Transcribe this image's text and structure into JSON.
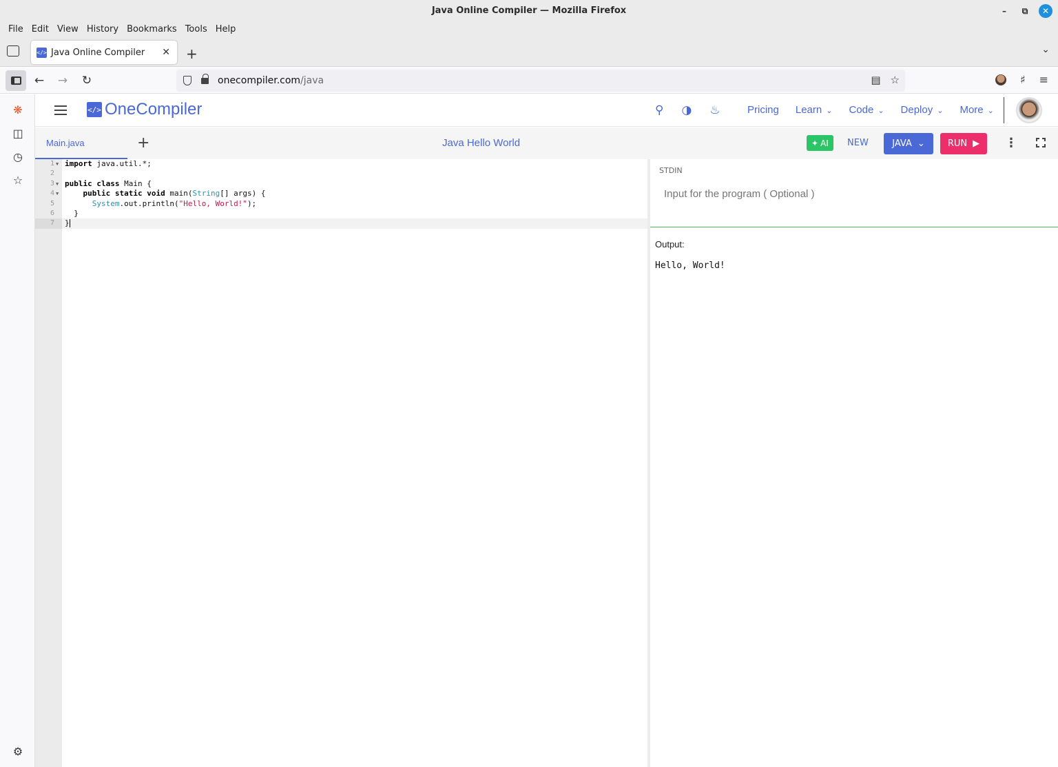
{
  "window": {
    "title": "Java Online Compiler — Mozilla Firefox"
  },
  "menu": [
    "File",
    "Edit",
    "View",
    "History",
    "Bookmarks",
    "Tools",
    "Help"
  ],
  "tab": {
    "favicon_text": "</>",
    "label": "Java Online Compiler"
  },
  "url": {
    "host": "onecompiler.com",
    "path": "/java"
  },
  "site": {
    "logo_text": "</>",
    "brand": "OneCompiler",
    "nav": [
      "Pricing",
      "Learn",
      "Code",
      "Deploy",
      "More"
    ]
  },
  "toolbar": {
    "file_tab": "Main.java",
    "code_title": "Java Hello World",
    "ai_label": "AI",
    "new_label": "NEW",
    "language_label": "JAVA",
    "run_label": "RUN"
  },
  "editor": {
    "lines": [
      {
        "num": "1",
        "fold": true
      },
      {
        "num": "2",
        "fold": false
      },
      {
        "num": "3",
        "fold": true
      },
      {
        "num": "4",
        "fold": true
      },
      {
        "num": "5",
        "fold": false
      },
      {
        "num": "6",
        "fold": false
      },
      {
        "num": "7",
        "fold": false
      }
    ]
  },
  "stdin": {
    "label": "STDIN",
    "placeholder": "Input for the program ( Optional )"
  },
  "output": {
    "label": "Output:",
    "text": "Hello, World!"
  },
  "colors": {
    "brand_blue": "#4a69d6",
    "ai_green": "#2bc466",
    "run_pink": "#ec2f6a"
  }
}
